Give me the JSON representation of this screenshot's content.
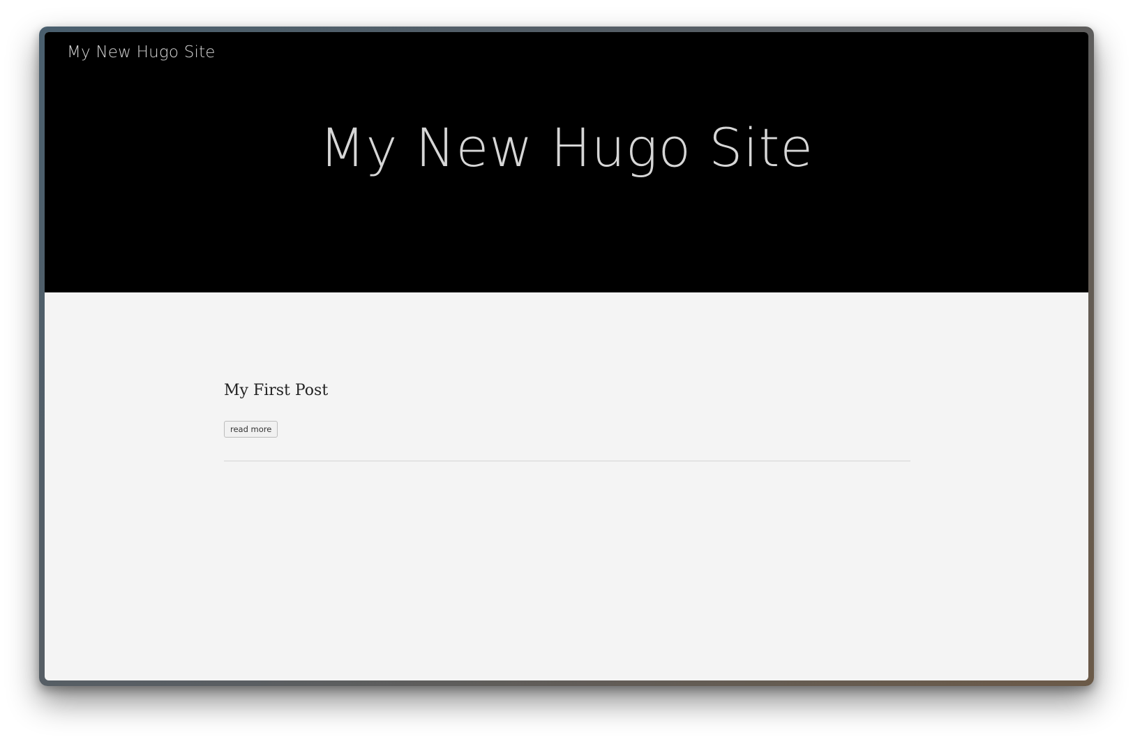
{
  "header": {
    "brand": "My New Hugo Site",
    "hero_title": "My New Hugo Site"
  },
  "posts": [
    {
      "title": "My First Post",
      "read_more_label": "read more"
    }
  ],
  "colors": {
    "hero_background": "#000000",
    "page_background": "#f4f4f4",
    "hero_text": "#d6d6d6"
  }
}
